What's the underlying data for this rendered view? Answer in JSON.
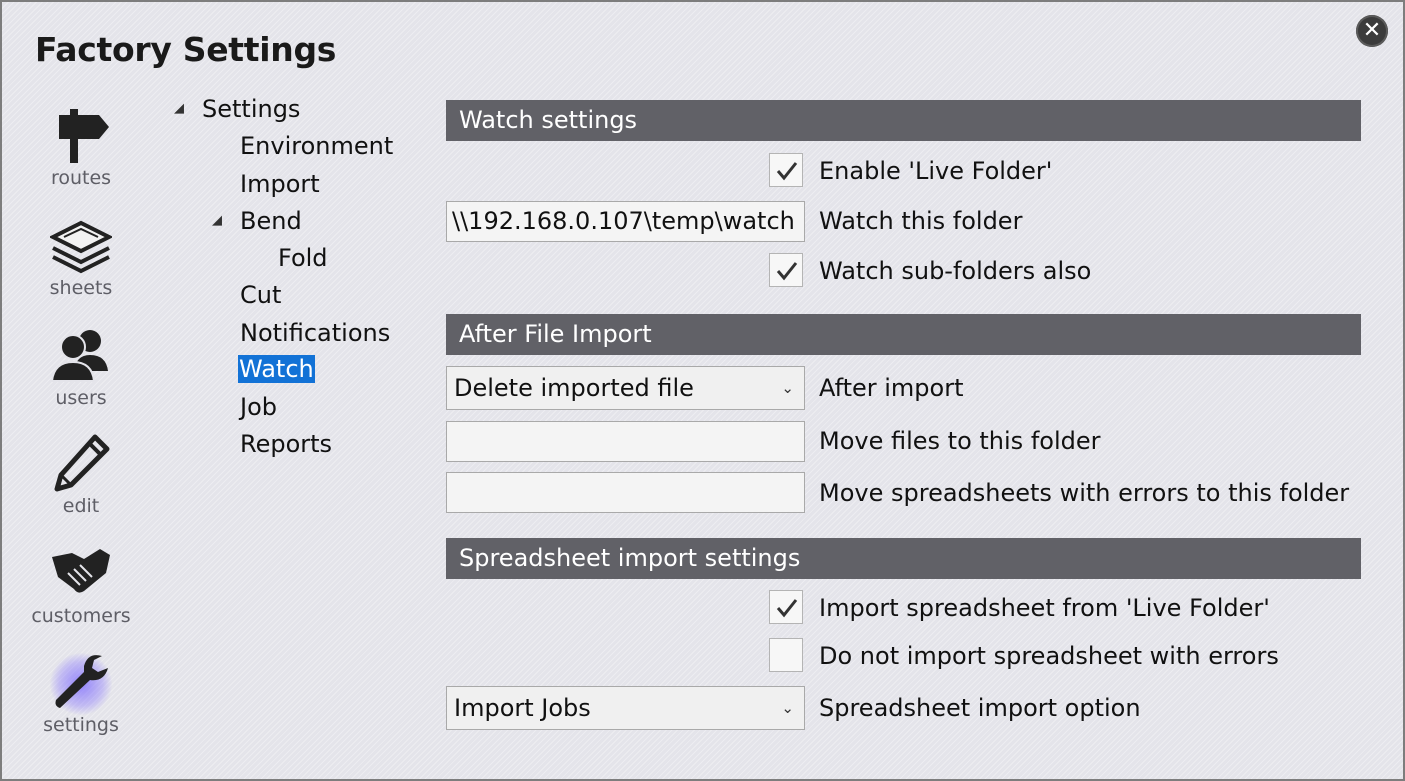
{
  "window": {
    "title": "Factory Settings",
    "close_icon": "close-icon"
  },
  "nav": [
    {
      "label": "routes",
      "icon": "signpost-icon"
    },
    {
      "label": "sheets",
      "icon": "stacked-sheets-icon"
    },
    {
      "label": "users",
      "icon": "users-icon"
    },
    {
      "label": "edit",
      "icon": "pencil-icon"
    },
    {
      "label": "customers",
      "icon": "handshake-icon"
    },
    {
      "label": "settings",
      "icon": "wrench-icon",
      "active": true
    }
  ],
  "tree": {
    "root": "Settings",
    "items": [
      "Environment",
      "Import",
      "Bend",
      "Fold",
      "Cut",
      "Notifications",
      "Watch",
      "Job",
      "Reports"
    ],
    "selected": "Watch"
  },
  "watch": {
    "header": "Watch settings",
    "enable_label": "Enable 'Live Folder'",
    "enable_checked": true,
    "folder_value": "\\\\192.168.0.107\\temp\\watch",
    "folder_label": "Watch this folder",
    "subfolders_label": "Watch sub-folders also",
    "subfolders_checked": true
  },
  "after_import": {
    "header": "After File Import",
    "action_value": "Delete imported file",
    "action_label": "After import",
    "move_folder_value": "",
    "move_folder_label": "Move files to this folder",
    "error_folder_value": "",
    "error_folder_label": "Move spreadsheets with errors to this folder"
  },
  "spreadsheet": {
    "header": "Spreadsheet import settings",
    "import_label": "Import spreadsheet from 'Live Folder'",
    "import_checked": true,
    "skip_errors_label": "Do not import spreadsheet with errors",
    "skip_errors_checked": false,
    "option_value": "Import Jobs",
    "option_label": "Spreadsheet import option"
  },
  "colors": {
    "accent": "#1272d6",
    "header_bg": "#616167",
    "icon": "#222222"
  }
}
